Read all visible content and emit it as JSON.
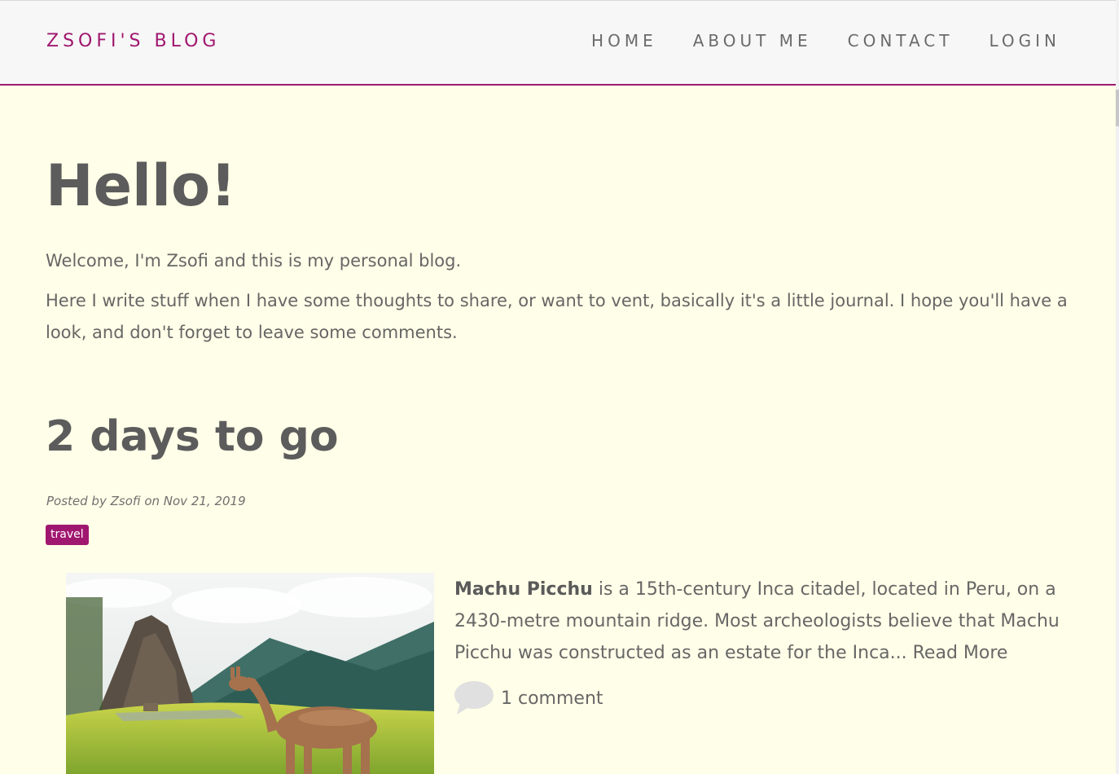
{
  "navbar": {
    "brand": "ZSOFI'S BLOG",
    "links": [
      "HOME",
      "ABOUT ME",
      "CONTACT",
      "LOGIN"
    ]
  },
  "intro": {
    "title": "Hello!",
    "line1": "Welcome, I'm Zsofi and this is my personal blog.",
    "line2": "Here I write stuff when I have some thoughts to share, or want to vent, basically it's a little journal. I hope you'll have a look, and don't forget to leave some comments."
  },
  "post": {
    "title": "2 days to go",
    "meta": "Posted by Zsofi on Nov 21, 2019",
    "tag": "travel",
    "excerpt_bold": "Machu Picchu",
    "excerpt_text": " is a 15th-century Inca citadel, located in Peru, on a 2430-metre mountain ridge. Most archeologists believe that Machu Picchu was constructed as an estate for the Inca... ",
    "read_more": "Read More",
    "comments": "1 comment",
    "comment_icon": "speech-bubble-icon"
  },
  "colors": {
    "accent": "#a0176f",
    "background": "#fffee8",
    "navbar_bg": "#f7f7f7",
    "text": "#5f5f5f"
  }
}
